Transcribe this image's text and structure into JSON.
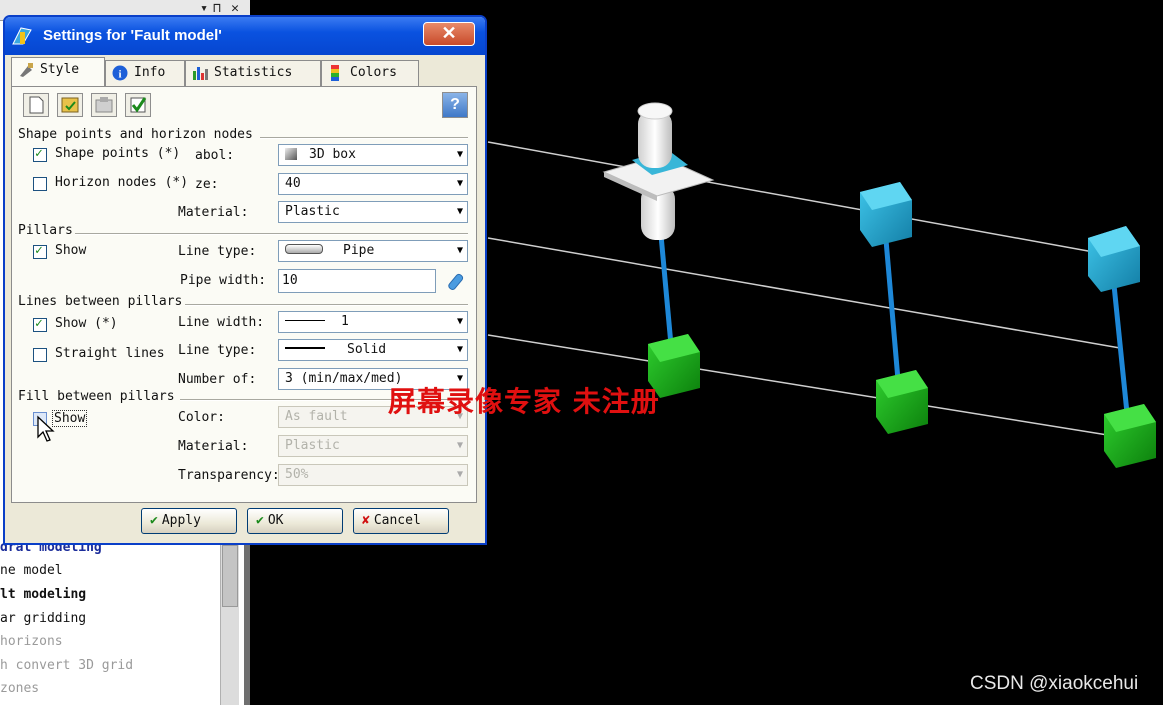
{
  "dialog": {
    "title": "Settings for 'Fault model'",
    "close_label": "✕",
    "tabs": [
      {
        "label": "Style"
      },
      {
        "label": "Info"
      },
      {
        "label": "Statistics"
      },
      {
        "label": "Colors"
      }
    ],
    "help_label": "?",
    "sections": {
      "shape": {
        "title": "Shape points and horizon nodes",
        "shape_points_label": "Shape points (*)",
        "symbol_label": "abol:",
        "symbol_value": "3D box",
        "horizon_nodes_label": "Horizon nodes (*)",
        "size_label": "ze:",
        "size_value": "40",
        "material_label": "Material:",
        "material_value": "Plastic"
      },
      "pillars": {
        "title": "Pillars",
        "show_label": "Show",
        "line_type_label": "Line type:",
        "line_type_value": "Pipe",
        "pipe_width_label": "Pipe width:",
        "pipe_width_value": "10"
      },
      "lines": {
        "title": "Lines between pillars",
        "show_label": "Show (*)",
        "straight_label": "Straight lines",
        "line_width_label": "Line width:",
        "line_width_value": "1",
        "line_type_label": "Line type:",
        "line_type_value": "Solid",
        "number_of_label": "Number of:",
        "number_of_value": "3 (min/max/med)"
      },
      "fill": {
        "title": "Fill between pillars",
        "show_label": "Show",
        "color_label": "Color:",
        "color_value": "As fault",
        "material_label": "Material:",
        "material_value": "Plastic",
        "transparency_label": "Transparency:",
        "transparency_value": "50%"
      }
    },
    "buttons": {
      "apply": "Apply",
      "ok": "OK",
      "cancel": "Cancel"
    }
  },
  "left_panel": {
    "items": [
      {
        "text": "dral modeling"
      },
      {
        "text": "ne model"
      },
      {
        "text": "lt modeling"
      },
      {
        "text": "ar gridding"
      },
      {
        "text": " horizons"
      },
      {
        "text": "h convert 3D grid"
      },
      {
        "text": " zones"
      }
    ]
  },
  "overlay": {
    "watermark": "屏幕录像专家   未注册",
    "credit": "CSDN @xiaokcehui"
  },
  "colors": {
    "titlebar": "#0a52e0",
    "pillar": "#1e88d8",
    "top_node": "#2aa8d0",
    "bottom_node": "#1fa81f",
    "watermark": "#e01010"
  }
}
